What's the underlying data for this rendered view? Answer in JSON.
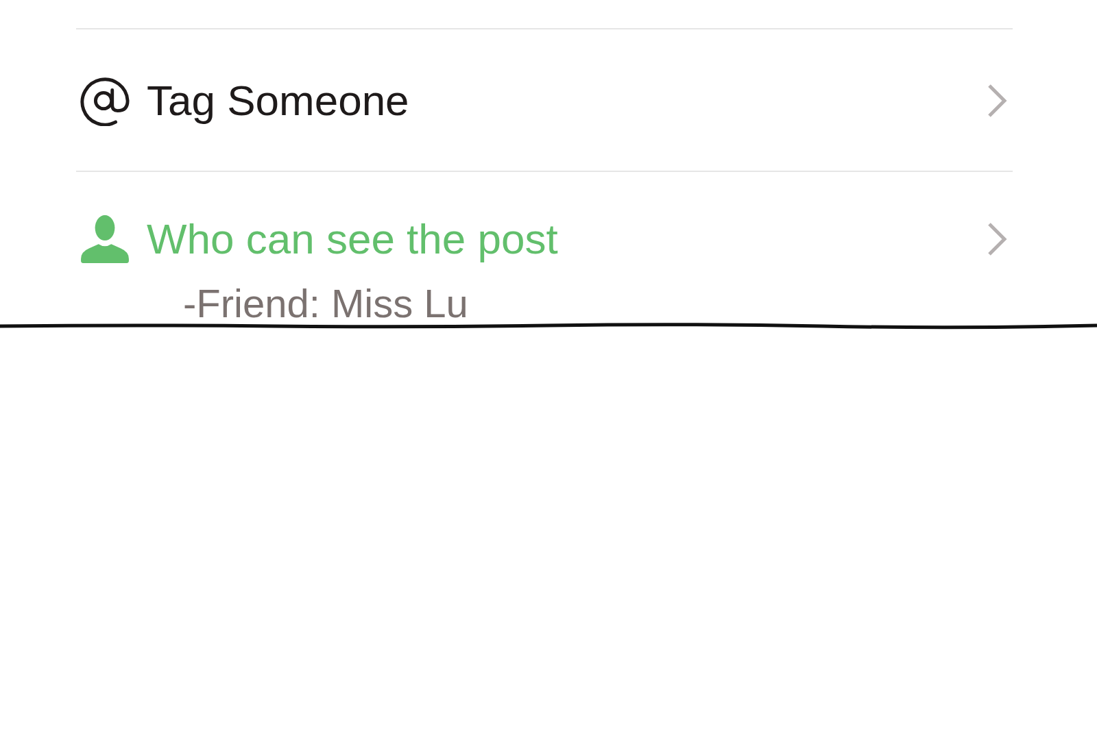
{
  "items": [
    {
      "kind": "tag",
      "label": "Tag Someone",
      "active": false
    },
    {
      "kind": "visibility",
      "label": "Who can see the post",
      "active": true,
      "detail": "-Friend: Miss Lu"
    }
  ]
}
